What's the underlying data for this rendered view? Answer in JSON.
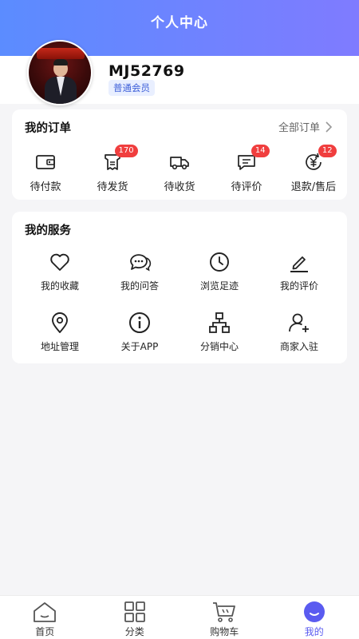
{
  "header": {
    "title": "个人中心"
  },
  "profile": {
    "username": "MJ52769",
    "member_level": "普通会员"
  },
  "orders": {
    "title": "我的订单",
    "all_label": "全部订单",
    "items": [
      {
        "label": "待付款",
        "icon": "wallet-icon",
        "badge": ""
      },
      {
        "label": "待发货",
        "icon": "receipt-icon",
        "badge": "170"
      },
      {
        "label": "待收货",
        "icon": "truck-icon",
        "badge": ""
      },
      {
        "label": "待评价",
        "icon": "comment-icon",
        "badge": "14"
      },
      {
        "label": "退款/售后",
        "icon": "refund-icon",
        "badge": "12"
      }
    ]
  },
  "services": {
    "title": "我的服务",
    "items": [
      {
        "label": "我的收藏",
        "icon": "heart-icon"
      },
      {
        "label": "我的问答",
        "icon": "chat-bubbles-icon"
      },
      {
        "label": "浏览足迹",
        "icon": "clock-icon"
      },
      {
        "label": "我的评价",
        "icon": "pen-icon"
      },
      {
        "label": "地址管理",
        "icon": "location-pin-icon"
      },
      {
        "label": "关于APP",
        "icon": "info-icon"
      },
      {
        "label": "分销中心",
        "icon": "hierarchy-icon"
      },
      {
        "label": "商家入驻",
        "icon": "user-add-icon"
      }
    ]
  },
  "nav": {
    "items": [
      {
        "label": "首页",
        "icon": "home-icon",
        "active": false
      },
      {
        "label": "分类",
        "icon": "grid-icon",
        "active": false
      },
      {
        "label": "购物车",
        "icon": "cart-icon",
        "active": false
      },
      {
        "label": "我的",
        "icon": "profile-icon",
        "active": true
      }
    ]
  },
  "colors": {
    "accent": "#5a5bf0",
    "badge": "#f03e3e",
    "header_start": "#5b8cff",
    "header_end": "#7f7bff"
  }
}
